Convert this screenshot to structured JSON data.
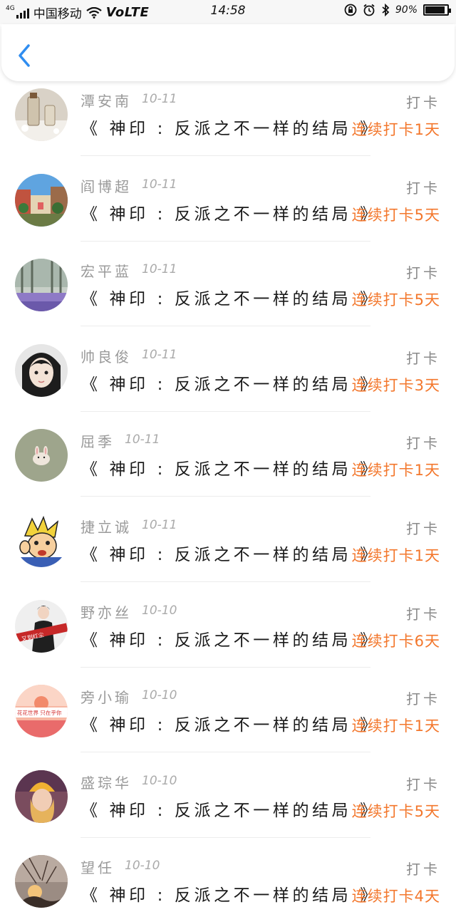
{
  "status_bar": {
    "network_tag": "4G",
    "carrier": "中国移动",
    "volte": "VoLTE",
    "time": "14:58",
    "battery_text": "90%",
    "battery_level": 0.9
  },
  "nav": {
    "back_icon": "chevron-left-icon",
    "accent_color": "#2f8df0"
  },
  "colors": {
    "streak": "#f3772c",
    "name": "#9a9a9a"
  },
  "feed": [
    {
      "name": "潭安南",
      "date": "10-11",
      "action": "打卡",
      "book": "《 神印 : 反派之不一样的结局 》",
      "streak": "连续打卡1天",
      "avatar": "jar-photo"
    },
    {
      "name": "阎博超",
      "date": "10-11",
      "action": "打卡",
      "book": "《 神印 : 反派之不一样的结局 》",
      "streak": "连续打卡5天",
      "avatar": "street-photo"
    },
    {
      "name": "宏平蓝",
      "date": "10-11",
      "action": "打卡",
      "book": "《 神印 : 反派之不一样的结局 》",
      "streak": "连续打卡5天",
      "avatar": "lavender-photo"
    },
    {
      "name": "帅良俊",
      "date": "10-11",
      "action": "打卡",
      "book": "《 神印 : 反派之不一样的结局 》",
      "streak": "连续打卡3天",
      "avatar": "girl-illustration"
    },
    {
      "name": "屈季",
      "date": "10-11",
      "action": "打卡",
      "book": "《 神印 : 反派之不一样的结局 》",
      "streak": "连续打卡1天",
      "avatar": "bunny-photo"
    },
    {
      "name": "捷立诚",
      "date": "10-11",
      "action": "打卡",
      "book": "《 神印 : 反派之不一样的结局 》",
      "streak": "连续打卡1天",
      "avatar": "cartoon-character"
    },
    {
      "name": "野亦丝",
      "date": "10-10",
      "action": "打卡",
      "book": "《 神印 : 反派之不一样的结局 》",
      "streak": "连续打卡6天",
      "avatar": "woman-banner-photo"
    },
    {
      "name": "旁小瑜",
      "date": "10-10",
      "action": "打卡",
      "book": "《 神印 : 反派之不一样的结局 》",
      "streak": "连续打卡1天",
      "avatar": "flower-world-banner"
    },
    {
      "name": "盛琮华",
      "date": "10-10",
      "action": "打卡",
      "book": "《 神印 : 反派之不一样的结局 》",
      "streak": "连续打卡5天",
      "avatar": "yellow-hat-girl"
    },
    {
      "name": "望任",
      "date": "10-10",
      "action": "打卡",
      "book": "《 神印 : 反派之不一样的结局 》",
      "streak": "连续打卡4天",
      "avatar": "sunset-branches-photo"
    }
  ],
  "avatar_texts": {
    "row7": "又到红尘",
    "row8": "花花世界 只在乎你"
  }
}
